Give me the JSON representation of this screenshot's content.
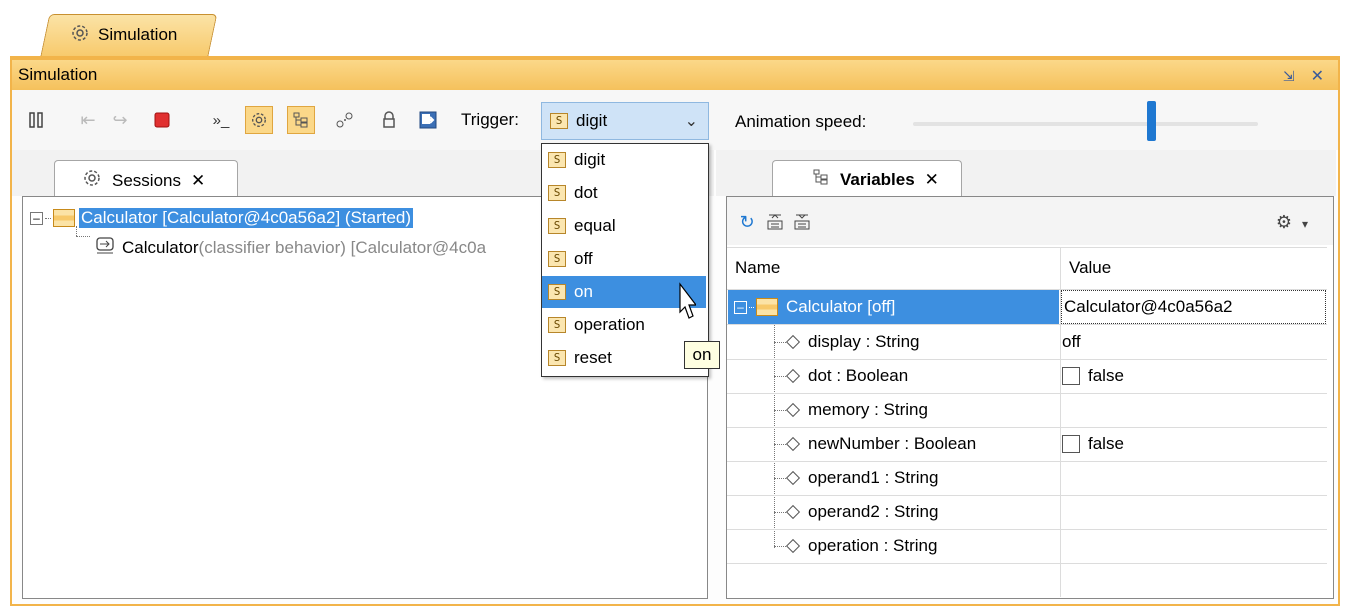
{
  "tab": {
    "label": "Simulation"
  },
  "window": {
    "title": "Simulation"
  },
  "toolbar": {
    "trigger_label": "Trigger:",
    "trigger_value": "digit",
    "animation_speed_label": "Animation speed:",
    "animation_speed": 0.69
  },
  "trigger_options": [
    {
      "label": "digit"
    },
    {
      "label": "dot"
    },
    {
      "label": "equal"
    },
    {
      "label": "off"
    },
    {
      "label": "on"
    },
    {
      "label": "operation"
    },
    {
      "label": "reset"
    }
  ],
  "tooltip": "on",
  "sessions": {
    "tab_label": "Sessions",
    "root": "Calculator [Calculator@4c0a56a2] (Started)",
    "child_name": "Calculator",
    "child_detail": "(classifier behavior) [Calculator@4c0a"
  },
  "variables": {
    "tab_label": "Variables",
    "col_name": "Name",
    "col_value": "Value",
    "root_name": "Calculator [off]",
    "root_value": "Calculator@4c0a56a2",
    "rows": [
      {
        "name": "display : String",
        "value": "off"
      },
      {
        "name": "dot : Boolean",
        "value": "false"
      },
      {
        "name": "memory : String",
        "value": ""
      },
      {
        "name": "newNumber : Boolean",
        "value": "false"
      },
      {
        "name": "operand1 : String",
        "value": ""
      },
      {
        "name": "operand2 : String",
        "value": ""
      },
      {
        "name": "operation : String",
        "value": ""
      }
    ]
  }
}
